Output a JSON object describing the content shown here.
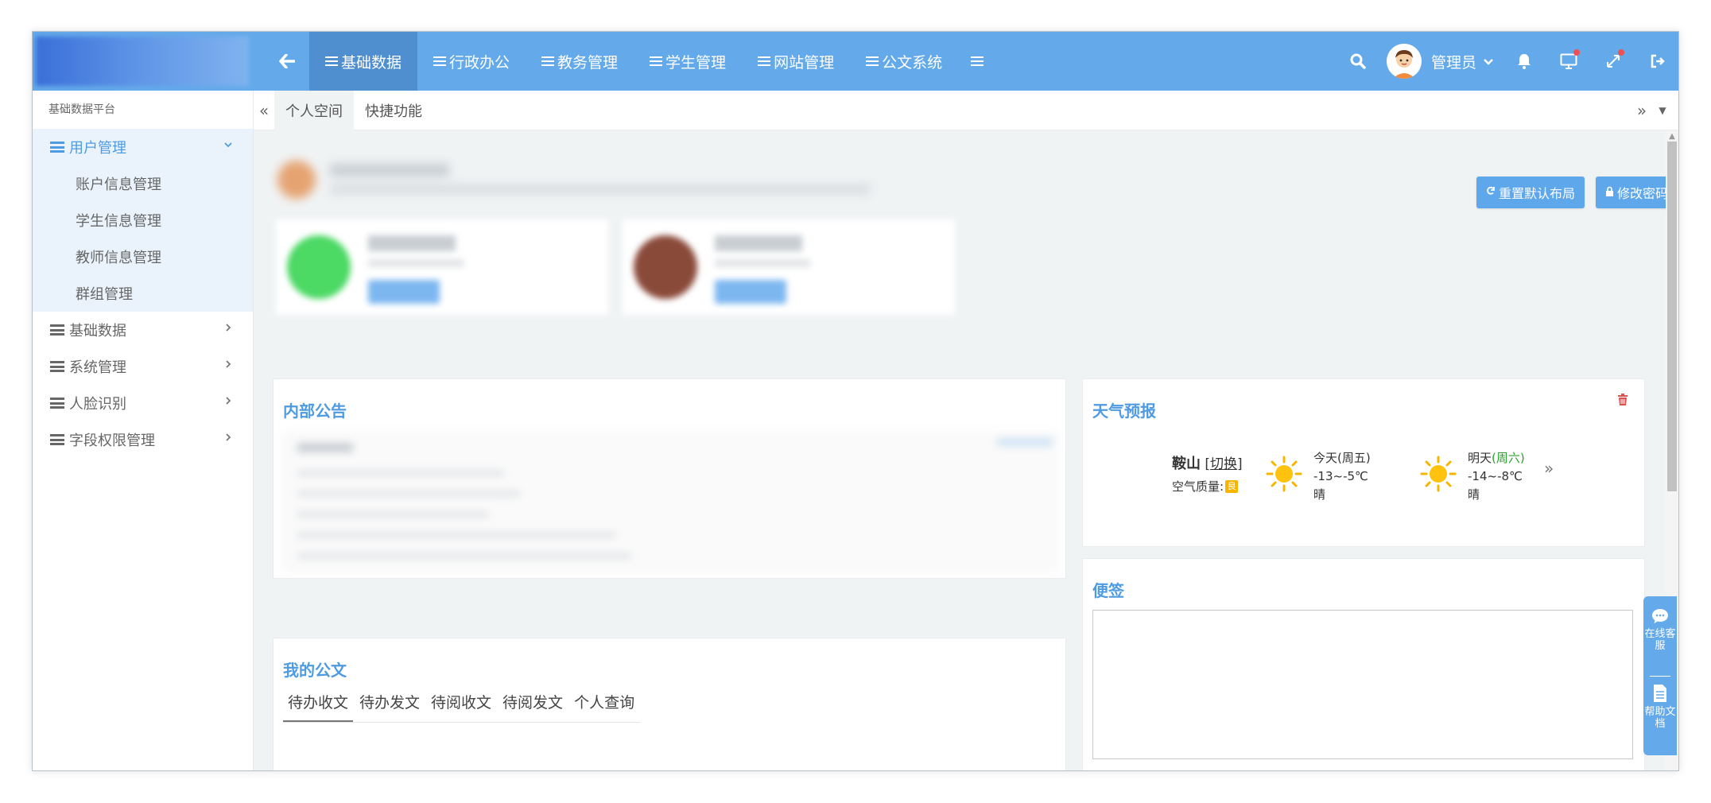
{
  "header": {
    "nav": [
      {
        "label": "基础数据",
        "active": true
      },
      {
        "label": "行政办公",
        "active": false
      },
      {
        "label": "教务管理",
        "active": false
      },
      {
        "label": "学生管理",
        "active": false
      },
      {
        "label": "网站管理",
        "active": false
      },
      {
        "label": "公文系统",
        "active": false
      }
    ],
    "user_name": "管理员",
    "colors": {
      "bar": "#64aaea",
      "active": "#4f8fd0",
      "badge": "#f05050"
    }
  },
  "sidebar": {
    "title": "基础数据平台",
    "groups": [
      {
        "label": "用户管理",
        "open": true,
        "items": [
          {
            "label": "账户信息管理"
          },
          {
            "label": "学生信息管理"
          },
          {
            "label": "教师信息管理"
          },
          {
            "label": "群组管理"
          }
        ]
      },
      {
        "label": "基础数据",
        "open": false
      },
      {
        "label": "系统管理",
        "open": false
      },
      {
        "label": "人脸识别",
        "open": false
      },
      {
        "label": "字段权限管理",
        "open": false
      }
    ]
  },
  "tabs": [
    {
      "label": "个人空间",
      "active": true
    },
    {
      "label": "快捷功能",
      "active": false
    }
  ],
  "actions": {
    "reset_layout": "重置默认布局",
    "change_password": "修改密码"
  },
  "notice": {
    "title": "内部公告"
  },
  "docs": {
    "title": "我的公文",
    "tabs": [
      "待办收文",
      "待办发文",
      "待阅收文",
      "待阅发文",
      "个人查询"
    ]
  },
  "weather": {
    "title": "天气预报",
    "city": "鞍山",
    "switch_label": "切换",
    "air_quality_label": "空气质量:",
    "air_quality_value": "良",
    "today": {
      "label": "今天",
      "weekday": "(周五)",
      "temp": "-13~-5℃",
      "desc": "晴"
    },
    "tomorrow": {
      "label": "明天",
      "weekday": "(周六)",
      "temp": "-14~-8℃",
      "desc": "晴"
    }
  },
  "notes": {
    "title": "便签",
    "value": ""
  },
  "float_service": {
    "chat_label": "在线客服",
    "help_label": "帮助文档"
  }
}
